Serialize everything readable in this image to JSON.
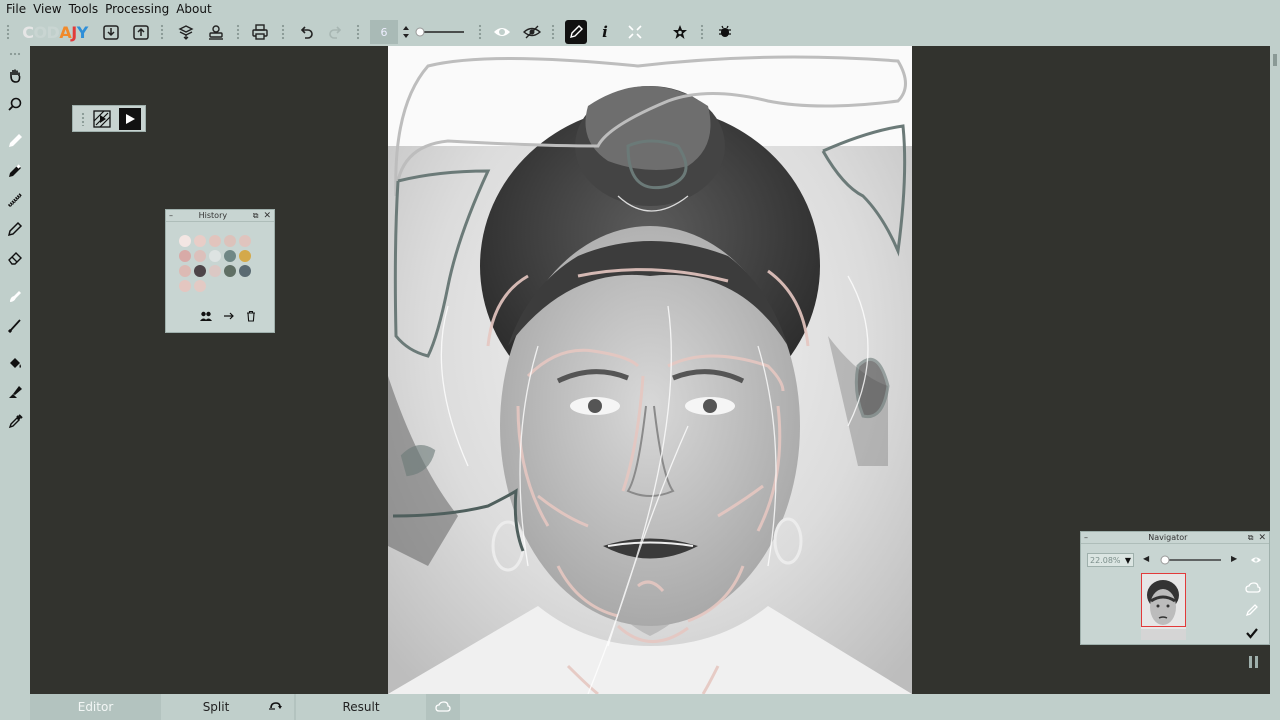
{
  "menu": {
    "file": "File",
    "view": "View",
    "tools": "Tools",
    "processing": "Processing",
    "about": "About"
  },
  "logo": {
    "p1": "C",
    "p2": "OD",
    "p3": "A",
    "p4": "J",
    "p5": "Y"
  },
  "toolbar": {
    "brush_size": "6"
  },
  "history": {
    "title": "History"
  },
  "swatch_colors": [
    "#f3e6e3",
    "#e8cdc7",
    "#e2c4bd",
    "#dcc2bb",
    "#e0c4be",
    "#d8aaa7",
    "#dcc0bb",
    "#dde3e2",
    "#6f8785",
    "#d4a94a",
    "#dcbab4",
    "#4e4549",
    "#dbc8c4",
    "#5f6f64",
    "#5a6a72",
    "#e4c6c0",
    "#e3cac4"
  ],
  "navigator": {
    "title": "Navigator",
    "zoom": "22.08%"
  },
  "bottom": {
    "editor": "Editor",
    "split": "Split",
    "result": "Result"
  }
}
